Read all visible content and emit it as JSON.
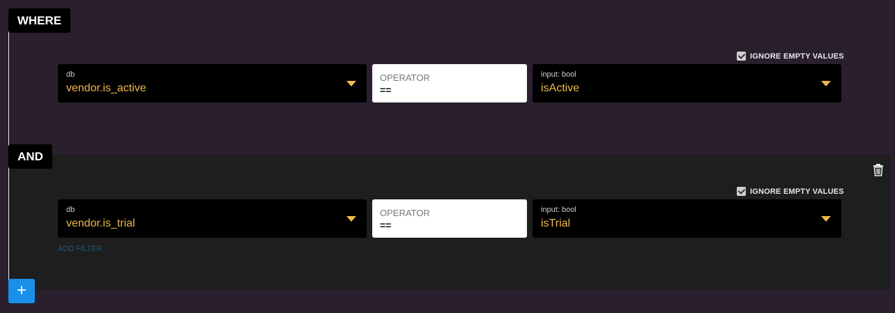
{
  "where_label": "WHERE",
  "and_label": "AND",
  "add_button_symbol": "+",
  "add_filter_label": "ADD FILTER",
  "colors": {
    "background": "#2a1f2d",
    "panel": "#1e1e1e",
    "accent_value": "#f0b84a",
    "add_button": "#1a8fe8",
    "add_filter_link": "#1d5a80"
  },
  "filters": [
    {
      "ignore_empty_values": {
        "label": "IGNORE EMPTY VALUES",
        "checked": true
      },
      "field": {
        "label": "db",
        "value": "vendor.is_active"
      },
      "operator": {
        "label": "OPERATOR",
        "value": "=="
      },
      "input": {
        "label": "input: bool",
        "value": "isActive"
      }
    },
    {
      "ignore_empty_values": {
        "label": "IGNORE EMPTY VALUES",
        "checked": true
      },
      "field": {
        "label": "db",
        "value": "vendor.is_trial"
      },
      "operator": {
        "label": "OPERATOR",
        "value": "=="
      },
      "input": {
        "label": "input: bool",
        "value": "isTrial"
      }
    }
  ],
  "icons": {
    "delete": "trash-icon",
    "dropdown": "chevron-down-icon",
    "checkbox": "checkbox-checked-icon",
    "add": "plus-icon"
  }
}
